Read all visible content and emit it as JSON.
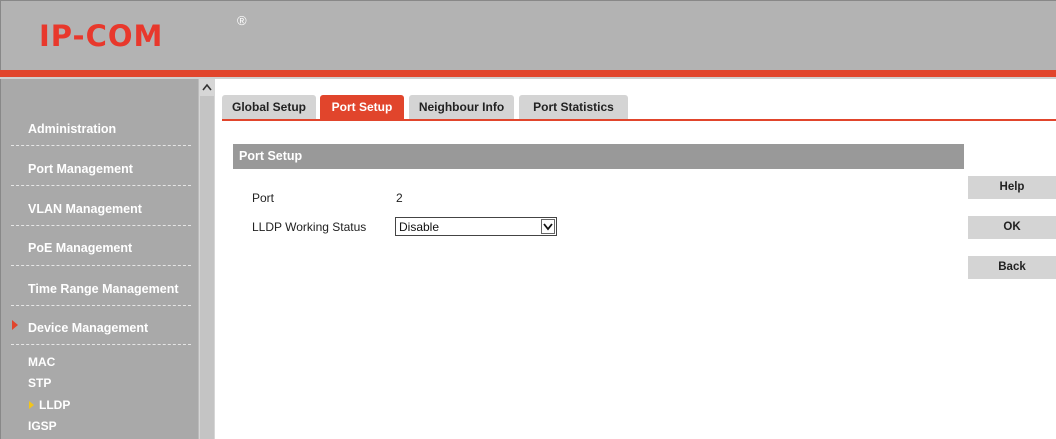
{
  "brand": {
    "logo": "IP-COM",
    "reg": "®"
  },
  "sidebar": {
    "items": [
      {
        "label": "Administration"
      },
      {
        "label": "Port Management"
      },
      {
        "label": "VLAN Management"
      },
      {
        "label": "PoE Management"
      },
      {
        "label": "Time Range Management"
      },
      {
        "label": "Device Management"
      }
    ],
    "subitems": [
      {
        "label": "MAC"
      },
      {
        "label": "STP"
      },
      {
        "label": "LLDP"
      },
      {
        "label": "IGSP"
      }
    ]
  },
  "tabs": [
    {
      "label": "Global Setup",
      "active": false
    },
    {
      "label": "Port Setup",
      "active": true
    },
    {
      "label": "Neighbour Info",
      "active": false
    },
    {
      "label": "Port Statistics",
      "active": false
    }
  ],
  "panel": {
    "title": "Port Setup",
    "port_label": "Port",
    "port_value": "2",
    "lldp_label": "LLDP Working Status",
    "lldp_value": "Disable"
  },
  "buttons": {
    "help": "Help",
    "ok": "OK",
    "back": "Back"
  },
  "colors": {
    "accent": "#e1452c",
    "header": "#b3b3b3",
    "sidebar": "#a9a9a9",
    "panel_title": "#999999",
    "button": "#d4d4d4"
  }
}
